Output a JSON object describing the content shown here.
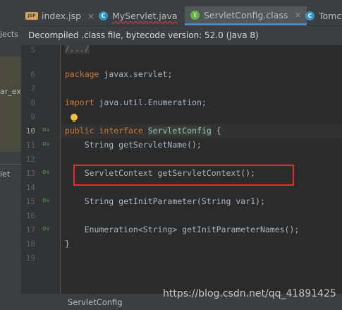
{
  "left_panel": {
    "items": [
      "jects",
      "ar_exp",
      "let"
    ]
  },
  "tabs": [
    {
      "label": "index.jsp",
      "icon": "jsp-file-icon",
      "icon_text": "JSP",
      "active": false
    },
    {
      "label": "MyServlet.java",
      "icon": "java-class-icon",
      "icon_text": "C",
      "active": false
    },
    {
      "label": "ServletConfig.class",
      "icon": "interface-icon",
      "icon_text": "I",
      "active": true
    },
    {
      "label": "Tomca",
      "icon": "java-class-icon",
      "icon_text": "C",
      "active": false
    }
  ],
  "tab_close_glyph": "×",
  "banner": {
    "text": "Decompiled .class file, bytecode version: 52.0 (Java 8)"
  },
  "line_numbers": [
    "5",
    "6",
    "7",
    "8",
    "9",
    "10",
    "11",
    "12",
    "13",
    "14",
    "15",
    "16",
    "17",
    "18",
    "19"
  ],
  "current_line": "10",
  "override_marker": "o↓",
  "code": {
    "fold": "/.../",
    "package_kw": "package",
    "package_name": " javax.servlet;",
    "import_kw": "import",
    "import_name": " java.util.Enumeration;",
    "iface_kw1": "public",
    "iface_kw2": "interface",
    "iface_name": "ServletConfig",
    "iface_brace": " {",
    "m1": "    String getServletName();",
    "m2": "    ServletContext getServletContext();",
    "m3": "    String getInitParameter(String var1);",
    "m4": "    Enumeration<String> getInitParameterNames();",
    "close": "}"
  },
  "status": {
    "breadcrumb": "ServletConfig"
  },
  "watermark": "https://blog.csdn.net/qq_41891425",
  "colors": {
    "keyword": "#cc7832",
    "text": "#a9b7c6",
    "highlight": "#e0302d",
    "active_tab_underline": "#4a88c7"
  }
}
